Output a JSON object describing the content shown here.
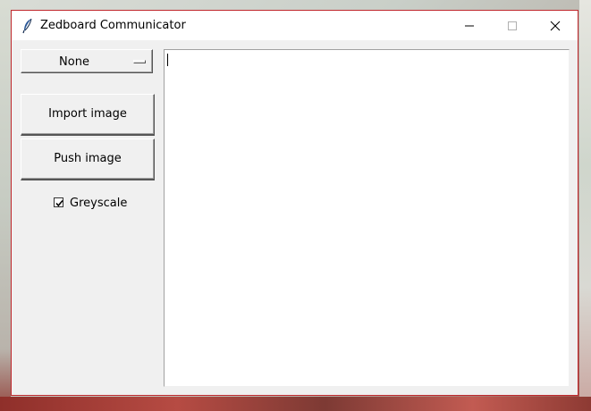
{
  "window": {
    "title": "Zedboard Communicator",
    "icon": "feather-icon",
    "controls": [
      "minimize-icon",
      "maximize-icon",
      "close-icon"
    ]
  },
  "sidebar": {
    "dropdown": {
      "selected": "None"
    },
    "import_button": "Import image",
    "push_button": "Push image",
    "greyscale": {
      "label": "Greyscale",
      "checked": true
    }
  },
  "main": {
    "text_area": {
      "value": ""
    }
  },
  "colors": {
    "window_border": "#c0282d",
    "client_bg": "#f0f0f0",
    "titlebar_bg": "#ffffff"
  }
}
